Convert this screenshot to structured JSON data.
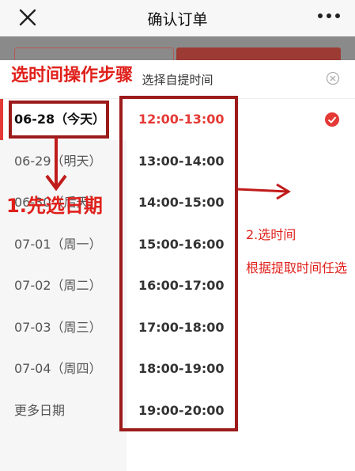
{
  "nav": {
    "title": "确认订单",
    "close_icon": "close-icon",
    "more_icon": "more-icon"
  },
  "sheet": {
    "title": "选择自提时间",
    "close_icon": "circle-close-icon",
    "dates": [
      "06-28（今天）",
      "06-29（明天）",
      "06-30（后天）",
      "07-01（周一）",
      "07-02（周二）",
      "07-03（周三）",
      "07-04（周四）",
      "更多日期"
    ],
    "selected_date_index": 0,
    "times": [
      "12:00-13:00",
      "13:00-14:00",
      "14:00-15:00",
      "15:00-16:00",
      "16:00-17:00",
      "17:00-18:00",
      "18:00-19:00",
      "19:00-20:00"
    ],
    "selected_time_index": 0
  },
  "annotations": {
    "heading": "选时间操作步骤",
    "step1": "1.先选日期",
    "step2": "2.选时间",
    "step2_note": "根据提取时间任选"
  },
  "colors": {
    "accent": "#e53935",
    "annotation": "#e0201b",
    "annotation_box": "#9c1b1b"
  }
}
